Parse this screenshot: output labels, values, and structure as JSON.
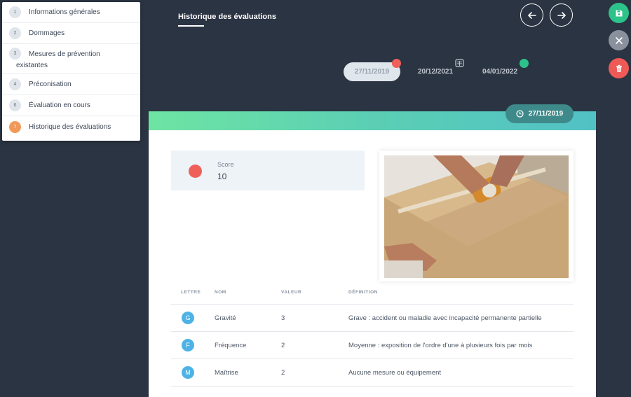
{
  "steps": [
    {
      "num": "1",
      "label": "Informations générales"
    },
    {
      "num": "2",
      "label": "Dommages"
    },
    {
      "num": "3",
      "label_line1": "Mesures de prévention",
      "label_line2": "existantes"
    },
    {
      "num": "4",
      "label": "Préconisation"
    },
    {
      "num": "6",
      "label": "Évaluation en cours"
    },
    {
      "num": "7",
      "label": "Historique des évaluations"
    }
  ],
  "header": {
    "title": "Historique des évaluations",
    "prev_icon": "arrow-left-icon",
    "next_icon": "arrow-right-icon"
  },
  "actions": [
    {
      "icon": "save-icon",
      "color": "#2cc38a"
    },
    {
      "icon": "close-icon",
      "color": "#8a919c"
    },
    {
      "icon": "trash-icon",
      "color": "#ef5a57"
    }
  ],
  "timeline": [
    {
      "date": "27/11/2019",
      "status_color": "#f0605a",
      "selected": true
    },
    {
      "date": "20/12/2021",
      "status_icon": "calendar-icon"
    },
    {
      "date": "04/01/2022",
      "status_color": "#2cc38a"
    }
  ],
  "card": {
    "date_badge": "27/11/2019",
    "score": {
      "label": "Score",
      "value": "10",
      "color": "#f0605a"
    }
  },
  "table": {
    "headers": [
      "LETTRE",
      "NOM",
      "VALEUR",
      "DÉFINITION"
    ],
    "rows": [
      {
        "letter": "G",
        "name": "Gravité",
        "value": "3",
        "definition": "Grave : accident ou maladie avec incapacité permanente partielle"
      },
      {
        "letter": "F",
        "name": "Fréquence",
        "value": "2",
        "definition": "Moyenne : exposition de l'ordre d'une à plusieurs fois par mois"
      },
      {
        "letter": "M",
        "name": "Maîtrise",
        "value": "2",
        "definition": "Aucune mesure ou équipement"
      }
    ]
  }
}
